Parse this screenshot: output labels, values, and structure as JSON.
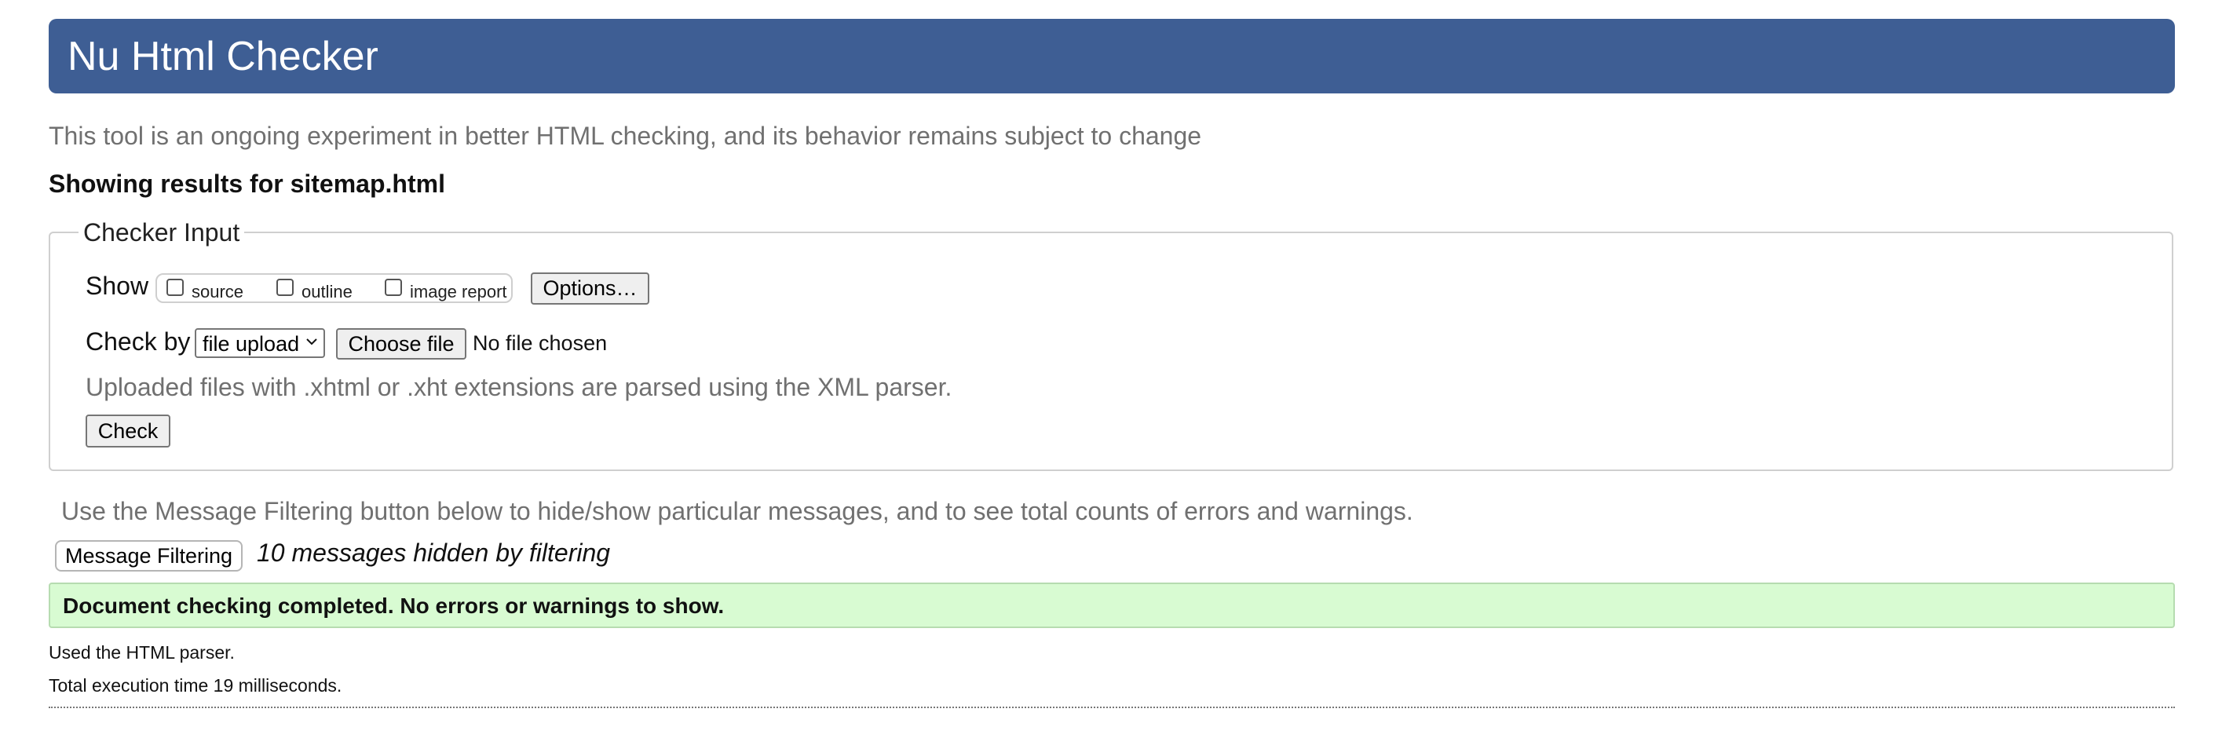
{
  "header": {
    "title": "Nu Html Checker"
  },
  "tagline": "This tool is an ongoing experiment in better HTML checking, and its behavior remains subject to change",
  "results_for": "Showing results for sitemap.html",
  "checker_input": {
    "legend": "Checker Input",
    "show_label": "Show",
    "checkboxes": [
      {
        "label": "source",
        "checked": false
      },
      {
        "label": "outline",
        "checked": false
      },
      {
        "label": "image report",
        "checked": false
      }
    ],
    "options_button": "Options…",
    "check_by_label": "Check by",
    "check_by_value": "file upload",
    "choose_file_button": "Choose file",
    "file_status": "No file chosen",
    "upload_note": "Uploaded files with .xhtml or .xht extensions are parsed using the XML parser.",
    "check_button": "Check"
  },
  "filter_note": "Use the Message Filtering button below to hide/show particular messages, and to see total counts of errors and warnings.",
  "filter_button": "Message Filtering",
  "hidden_messages": "10 messages hidden by filtering",
  "success_message": "Document checking completed. No errors or warnings to show.",
  "parser_note": "Used the HTML parser.",
  "execution_time": "Total execution time 19 milliseconds.",
  "colors": {
    "header_bg": "#3e5e94",
    "success_bg": "#d8fbd2",
    "muted_text": "#707070"
  }
}
